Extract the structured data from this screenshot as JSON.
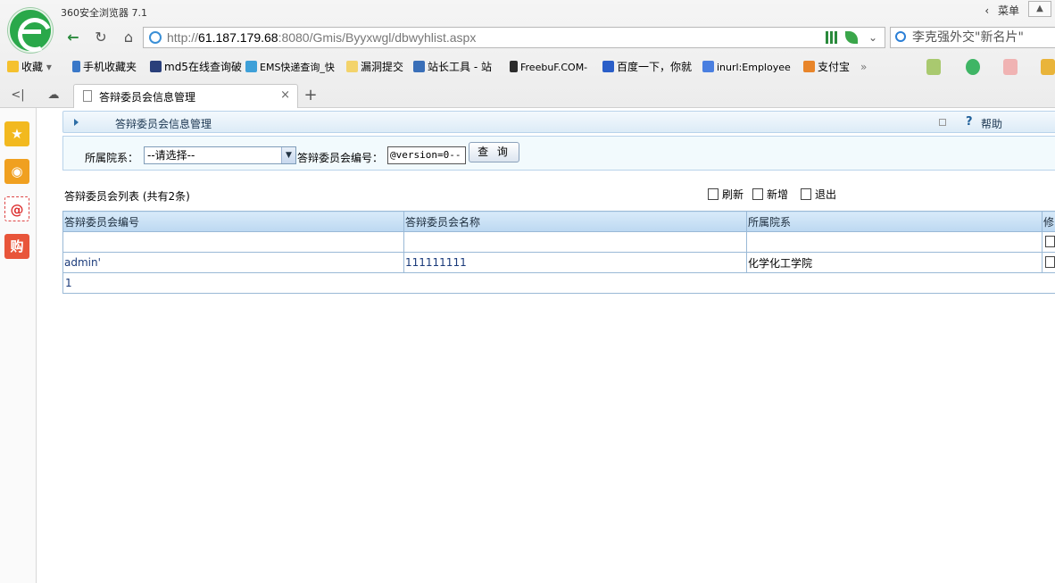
{
  "browser": {
    "app_title": "360安全浏览器 7.1",
    "menu_label": "菜单",
    "url_prefix": "http://",
    "url_host": "61.187.179.68",
    "url_rest": ":8080/Gmis/Byyxwgl/dbwyhlist.aspx",
    "search_text": "李克强外交\"新名片\"",
    "bookmarks": [
      "收藏",
      "手机收藏夹",
      "md5在线查询破",
      "EMS快递查询_快",
      "漏洞提交",
      "站长工具 - 站",
      "FreebuF.COM-",
      "百度一下，你就",
      "inurl:Employee",
      "支付宝"
    ],
    "tab_title": "答辩委员会信息管理"
  },
  "page": {
    "title": "答辩委员会信息管理",
    "help_label": "帮助",
    "search": {
      "dept_label": "所属院系：",
      "dept_value": "--请选择--",
      "code_label": "答辩委员会编号：",
      "code_value": "@version=0--",
      "query_button": "查 询"
    },
    "list_caption": "答辩委员会列表 (共有2条)",
    "actions": {
      "refresh": "刷新",
      "add": "新增",
      "exit": "退出"
    },
    "table": {
      "headers": [
        "答辩委员会编号",
        "答辩委员会名称",
        "所属院系",
        "修"
      ],
      "rows": [
        [
          "",
          "",
          ""
        ],
        [
          "admin'",
          "111111111",
          "化学化工学院"
        ]
      ]
    },
    "pager": "1"
  },
  "colors": {
    "accent_green": "#2aa84a",
    "header_blue": "#bcd8f1",
    "border_blue": "#9ab9d6"
  }
}
